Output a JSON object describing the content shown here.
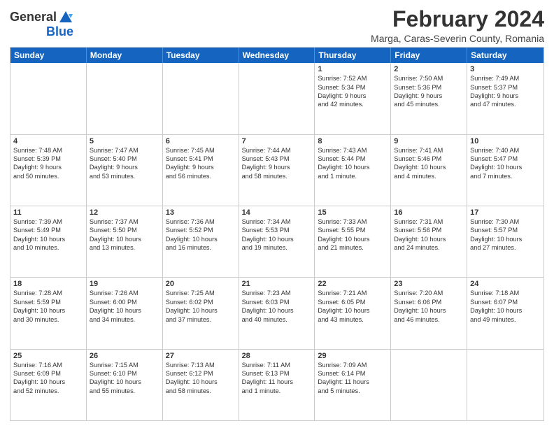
{
  "logo": {
    "general": "General",
    "blue": "Blue"
  },
  "header": {
    "month": "February 2024",
    "location": "Marga, Caras-Severin County, Romania"
  },
  "days": [
    "Sunday",
    "Monday",
    "Tuesday",
    "Wednesday",
    "Thursday",
    "Friday",
    "Saturday"
  ],
  "rows": [
    [
      {
        "day": "",
        "lines": []
      },
      {
        "day": "",
        "lines": []
      },
      {
        "day": "",
        "lines": []
      },
      {
        "day": "",
        "lines": []
      },
      {
        "day": "1",
        "lines": [
          "Sunrise: 7:52 AM",
          "Sunset: 5:34 PM",
          "Daylight: 9 hours",
          "and 42 minutes."
        ]
      },
      {
        "day": "2",
        "lines": [
          "Sunrise: 7:50 AM",
          "Sunset: 5:36 PM",
          "Daylight: 9 hours",
          "and 45 minutes."
        ]
      },
      {
        "day": "3",
        "lines": [
          "Sunrise: 7:49 AM",
          "Sunset: 5:37 PM",
          "Daylight: 9 hours",
          "and 47 minutes."
        ]
      }
    ],
    [
      {
        "day": "4",
        "lines": [
          "Sunrise: 7:48 AM",
          "Sunset: 5:39 PM",
          "Daylight: 9 hours",
          "and 50 minutes."
        ]
      },
      {
        "day": "5",
        "lines": [
          "Sunrise: 7:47 AM",
          "Sunset: 5:40 PM",
          "Daylight: 9 hours",
          "and 53 minutes."
        ]
      },
      {
        "day": "6",
        "lines": [
          "Sunrise: 7:45 AM",
          "Sunset: 5:41 PM",
          "Daylight: 9 hours",
          "and 56 minutes."
        ]
      },
      {
        "day": "7",
        "lines": [
          "Sunrise: 7:44 AM",
          "Sunset: 5:43 PM",
          "Daylight: 9 hours",
          "and 58 minutes."
        ]
      },
      {
        "day": "8",
        "lines": [
          "Sunrise: 7:43 AM",
          "Sunset: 5:44 PM",
          "Daylight: 10 hours",
          "and 1 minute."
        ]
      },
      {
        "day": "9",
        "lines": [
          "Sunrise: 7:41 AM",
          "Sunset: 5:46 PM",
          "Daylight: 10 hours",
          "and 4 minutes."
        ]
      },
      {
        "day": "10",
        "lines": [
          "Sunrise: 7:40 AM",
          "Sunset: 5:47 PM",
          "Daylight: 10 hours",
          "and 7 minutes."
        ]
      }
    ],
    [
      {
        "day": "11",
        "lines": [
          "Sunrise: 7:39 AM",
          "Sunset: 5:49 PM",
          "Daylight: 10 hours",
          "and 10 minutes."
        ]
      },
      {
        "day": "12",
        "lines": [
          "Sunrise: 7:37 AM",
          "Sunset: 5:50 PM",
          "Daylight: 10 hours",
          "and 13 minutes."
        ]
      },
      {
        "day": "13",
        "lines": [
          "Sunrise: 7:36 AM",
          "Sunset: 5:52 PM",
          "Daylight: 10 hours",
          "and 16 minutes."
        ]
      },
      {
        "day": "14",
        "lines": [
          "Sunrise: 7:34 AM",
          "Sunset: 5:53 PM",
          "Daylight: 10 hours",
          "and 19 minutes."
        ]
      },
      {
        "day": "15",
        "lines": [
          "Sunrise: 7:33 AM",
          "Sunset: 5:55 PM",
          "Daylight: 10 hours",
          "and 21 minutes."
        ]
      },
      {
        "day": "16",
        "lines": [
          "Sunrise: 7:31 AM",
          "Sunset: 5:56 PM",
          "Daylight: 10 hours",
          "and 24 minutes."
        ]
      },
      {
        "day": "17",
        "lines": [
          "Sunrise: 7:30 AM",
          "Sunset: 5:57 PM",
          "Daylight: 10 hours",
          "and 27 minutes."
        ]
      }
    ],
    [
      {
        "day": "18",
        "lines": [
          "Sunrise: 7:28 AM",
          "Sunset: 5:59 PM",
          "Daylight: 10 hours",
          "and 30 minutes."
        ]
      },
      {
        "day": "19",
        "lines": [
          "Sunrise: 7:26 AM",
          "Sunset: 6:00 PM",
          "Daylight: 10 hours",
          "and 34 minutes."
        ]
      },
      {
        "day": "20",
        "lines": [
          "Sunrise: 7:25 AM",
          "Sunset: 6:02 PM",
          "Daylight: 10 hours",
          "and 37 minutes."
        ]
      },
      {
        "day": "21",
        "lines": [
          "Sunrise: 7:23 AM",
          "Sunset: 6:03 PM",
          "Daylight: 10 hours",
          "and 40 minutes."
        ]
      },
      {
        "day": "22",
        "lines": [
          "Sunrise: 7:21 AM",
          "Sunset: 6:05 PM",
          "Daylight: 10 hours",
          "and 43 minutes."
        ]
      },
      {
        "day": "23",
        "lines": [
          "Sunrise: 7:20 AM",
          "Sunset: 6:06 PM",
          "Daylight: 10 hours",
          "and 46 minutes."
        ]
      },
      {
        "day": "24",
        "lines": [
          "Sunrise: 7:18 AM",
          "Sunset: 6:07 PM",
          "Daylight: 10 hours",
          "and 49 minutes."
        ]
      }
    ],
    [
      {
        "day": "25",
        "lines": [
          "Sunrise: 7:16 AM",
          "Sunset: 6:09 PM",
          "Daylight: 10 hours",
          "and 52 minutes."
        ]
      },
      {
        "day": "26",
        "lines": [
          "Sunrise: 7:15 AM",
          "Sunset: 6:10 PM",
          "Daylight: 10 hours",
          "and 55 minutes."
        ]
      },
      {
        "day": "27",
        "lines": [
          "Sunrise: 7:13 AM",
          "Sunset: 6:12 PM",
          "Daylight: 10 hours",
          "and 58 minutes."
        ]
      },
      {
        "day": "28",
        "lines": [
          "Sunrise: 7:11 AM",
          "Sunset: 6:13 PM",
          "Daylight: 11 hours",
          "and 1 minute."
        ]
      },
      {
        "day": "29",
        "lines": [
          "Sunrise: 7:09 AM",
          "Sunset: 6:14 PM",
          "Daylight: 11 hours",
          "and 5 minutes."
        ]
      },
      {
        "day": "",
        "lines": []
      },
      {
        "day": "",
        "lines": []
      }
    ]
  ]
}
